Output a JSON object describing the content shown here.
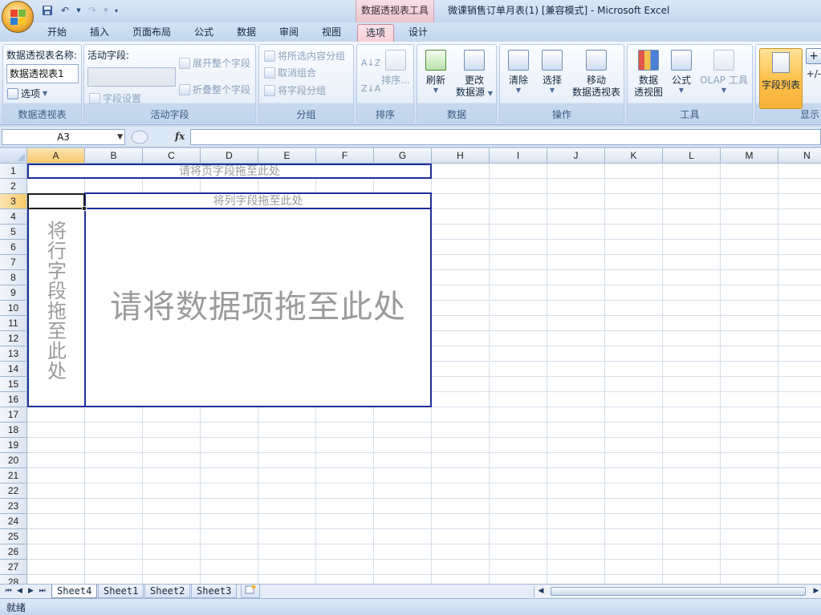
{
  "window": {
    "context_tab_title": "数据透视表工具",
    "doc_title": "微课销售订单月表(1)  [兼容模式]  -  Microsoft Excel"
  },
  "tabs": [
    {
      "label": "开始"
    },
    {
      "label": "插入"
    },
    {
      "label": "页面布局"
    },
    {
      "label": "公式"
    },
    {
      "label": "数据"
    },
    {
      "label": "审阅"
    },
    {
      "label": "视图"
    },
    {
      "label": "选项",
      "active": true
    },
    {
      "label": "设计"
    }
  ],
  "ribbon": {
    "pivot_name": {
      "label": "数据透视表名称:",
      "value": "数据透视表1",
      "options_label": "选项",
      "group_label": "数据透视表"
    },
    "active_field": {
      "label": "活动字段:",
      "value": "",
      "field_settings": "字段设置",
      "expand_all": "展开整个字段",
      "collapse_all": "折叠整个字段",
      "group_label": "活动字段"
    },
    "group": {
      "group_selection": "将所选内容分组",
      "ungroup": "取消组合",
      "group_field": "将字段分组",
      "group_label": "分组"
    },
    "sort": {
      "sort_label": "排序...",
      "group_label": "排序"
    },
    "data": {
      "refresh": "刷新",
      "change_source_1": "更改",
      "change_source_2": "数据源",
      "group_label": "数据"
    },
    "actions": {
      "clear": "清除",
      "select": "选择",
      "move_1": "移动",
      "move_2": "数据透视表",
      "group_label": "操作"
    },
    "tools": {
      "pivot_chart_1": "数据",
      "pivot_chart_2": "透视图",
      "formulas": "公式",
      "olap": "OLAP 工具",
      "group_label": "工具"
    },
    "show": {
      "field_list": "字段列表",
      "plus_minus": "+/-",
      "group_label": "显示"
    }
  },
  "formula_bar": {
    "name_box": "A3",
    "fx": "fx",
    "value": ""
  },
  "grid": {
    "columns": [
      "A",
      "B",
      "C",
      "D",
      "E",
      "F",
      "G",
      "H",
      "I",
      "J",
      "K",
      "L",
      "M",
      "N"
    ],
    "rows": [
      "1",
      "2",
      "3",
      "4",
      "5",
      "6",
      "7",
      "8",
      "9",
      "10",
      "11",
      "12",
      "13",
      "14",
      "15",
      "16",
      "17",
      "18",
      "19",
      "20",
      "21",
      "22",
      "23",
      "24",
      "25",
      "26",
      "27",
      "28"
    ],
    "selected_column": "A",
    "selected_row": "3"
  },
  "pivot_layout": {
    "page_drop": "请将页字段拖至此处",
    "column_drop": "将列字段拖至此处",
    "row_drop": "将行字段拖至此处",
    "data_drop": "请将数据项拖至此处"
  },
  "sheet_tabs": [
    {
      "label": "Sheet4",
      "active": true
    },
    {
      "label": "Sheet1"
    },
    {
      "label": "Sheet2"
    },
    {
      "label": "Sheet3"
    }
  ],
  "status": {
    "text": "就绪"
  }
}
